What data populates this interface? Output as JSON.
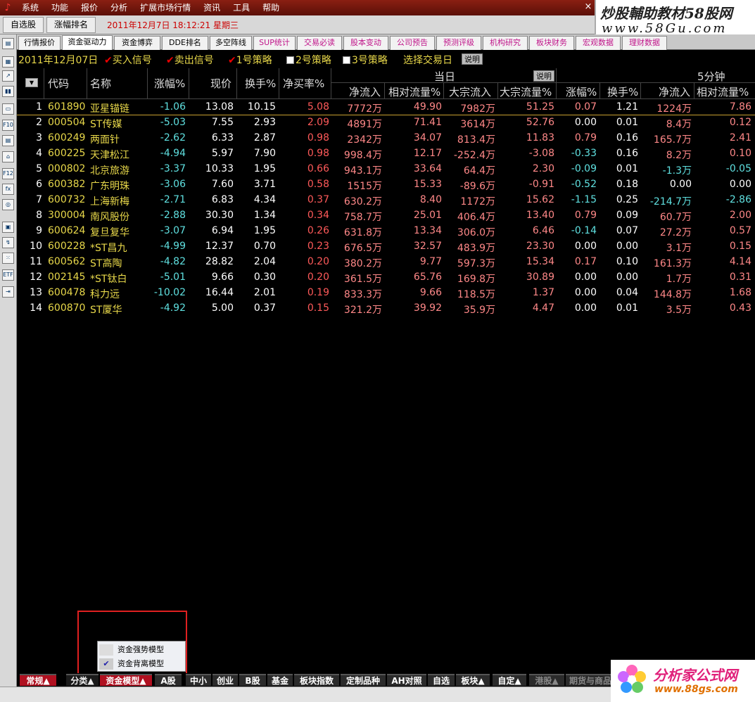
{
  "menu": {
    "items": [
      "系统",
      "功能",
      "报价",
      "分析",
      "扩展市场行情",
      "资讯",
      "工具",
      "帮助"
    ],
    "close": "×"
  },
  "watermark_top": {
    "line1": "炒股輔助教材58股网",
    "line2": "www.58Gu.com"
  },
  "toolbar": {
    "btn1": "自选股",
    "btn2": "涨幅排名",
    "datetime": "2011年12月7日  18:12:21 星期三"
  },
  "left_icons": [
    "▤",
    "▦",
    "↗",
    "▮▮",
    "▭",
    "F10",
    "▤",
    "⌂",
    "F12",
    "fx",
    "◎",
    "▣",
    "↯",
    "⁙",
    "ETF",
    "⇥"
  ],
  "tabs": [
    "行情报价",
    "资金驱动力",
    "资金博弈",
    "DDE排名",
    "多空阵线",
    "SUP统计",
    "交易必读",
    "股本变动",
    "公司预告",
    "预测评级",
    "机构研究",
    "板块财务",
    "宏观数据",
    "理财数据"
  ],
  "strategy": {
    "date": "2011年12月07日",
    "buy": "买入信号",
    "sell": "卖出信号",
    "s1": "1号策略",
    "s2": "2号策略",
    "s3": "3号策略",
    "select": "选择交易日",
    "explain": "说明"
  },
  "header": {
    "code": "代码",
    "name": "名称",
    "pct": "涨幅%",
    "price": "现价",
    "turnover": "换手%",
    "netbuy": "净买率%",
    "today": "当日",
    "explain": "说明",
    "five": "5分钟",
    "today_cols": [
      "净流入",
      "相对流量%",
      "大宗流入",
      "大宗流量%"
    ],
    "five_cols": [
      "涨幅%",
      "换手%",
      "净流入",
      "相对流量%"
    ]
  },
  "rows": [
    {
      "i": "1",
      "code": "601890",
      "name": "亚星锚链",
      "pct": "-1.06",
      "price": "13.08",
      "to": "10.15",
      "nb": "5.08",
      "ni": "7772万",
      "rf": "49.90",
      "bi": "7982万",
      "bf": "51.25",
      "p5": "0.07",
      "t5": "1.21",
      "n5": "1224万",
      "r5": "7.86"
    },
    {
      "i": "2",
      "code": "000504",
      "name": "ST传媒",
      "pct": "-5.03",
      "price": "7.55",
      "to": "2.93",
      "nb": "2.09",
      "ni": "4891万",
      "rf": "71.41",
      "bi": "3614万",
      "bf": "52.76",
      "p5": "0.00",
      "t5": "0.01",
      "n5": "8.4万",
      "r5": "0.12"
    },
    {
      "i": "3",
      "code": "600249",
      "name": "两面针",
      "pct": "-2.62",
      "price": "6.33",
      "to": "2.87",
      "nb": "0.98",
      "ni": "2342万",
      "rf": "34.07",
      "bi": "813.4万",
      "bf": "11.83",
      "p5": "0.79",
      "t5": "0.16",
      "n5": "165.7万",
      "r5": "2.41"
    },
    {
      "i": "4",
      "code": "600225",
      "name": "天津松江",
      "pct": "-4.94",
      "price": "5.97",
      "to": "7.90",
      "nb": "0.98",
      "ni": "998.4万",
      "rf": "12.17",
      "bi": "-252.4万",
      "bf": "-3.08",
      "p5": "-0.33",
      "t5": "0.16",
      "n5": "8.2万",
      "r5": "0.10"
    },
    {
      "i": "5",
      "code": "000802",
      "name": "北京旅游",
      "pct": "-3.37",
      "price": "10.33",
      "to": "1.95",
      "nb": "0.66",
      "ni": "943.1万",
      "rf": "33.64",
      "bi": "64.4万",
      "bf": "2.30",
      "p5": "-0.09",
      "t5": "0.01",
      "n5": "-1.3万",
      "r5": "-0.05"
    },
    {
      "i": "6",
      "code": "600382",
      "name": "广东明珠",
      "pct": "-3.06",
      "price": "7.60",
      "to": "3.71",
      "nb": "0.58",
      "ni": "1515万",
      "rf": "15.33",
      "bi": "-89.6万",
      "bf": "-0.91",
      "p5": "-0.52",
      "t5": "0.18",
      "n5": "0.00",
      "r5": "0.00"
    },
    {
      "i": "7",
      "code": "600732",
      "name": "上海新梅",
      "pct": "-2.71",
      "price": "6.83",
      "to": "4.34",
      "nb": "0.37",
      "ni": "630.2万",
      "rf": "8.40",
      "bi": "1172万",
      "bf": "15.62",
      "p5": "-1.15",
      "t5": "0.25",
      "n5": "-214.7万",
      "r5": "-2.86"
    },
    {
      "i": "8",
      "code": "300004",
      "name": "南风股份",
      "pct": "-2.88",
      "price": "30.30",
      "to": "1.34",
      "nb": "0.34",
      "ni": "758.7万",
      "rf": "25.01",
      "bi": "406.4万",
      "bf": "13.40",
      "p5": "0.79",
      "t5": "0.09",
      "n5": "60.7万",
      "r5": "2.00"
    },
    {
      "i": "9",
      "code": "600624",
      "name": "复旦复华",
      "pct": "-3.07",
      "price": "6.94",
      "to": "1.95",
      "nb": "0.26",
      "ni": "631.8万",
      "rf": "13.34",
      "bi": "306.0万",
      "bf": "6.46",
      "p5": "-0.14",
      "t5": "0.07",
      "n5": "27.2万",
      "r5": "0.57"
    },
    {
      "i": "10",
      "code": "600228",
      "name": "*ST昌九",
      "pct": "-4.99",
      "price": "12.37",
      "to": "0.70",
      "nb": "0.23",
      "ni": "676.5万",
      "rf": "32.57",
      "bi": "483.9万",
      "bf": "23.30",
      "p5": "0.00",
      "t5": "0.00",
      "n5": "3.1万",
      "r5": "0.15"
    },
    {
      "i": "11",
      "code": "600562",
      "name": "ST高陶",
      "pct": "-4.82",
      "price": "28.82",
      "to": "2.04",
      "nb": "0.20",
      "ni": "380.2万",
      "rf": "9.77",
      "bi": "597.3万",
      "bf": "15.34",
      "p5": "0.17",
      "t5": "0.10",
      "n5": "161.3万",
      "r5": "4.14"
    },
    {
      "i": "12",
      "code": "002145",
      "name": "*ST钛白",
      "pct": "-5.01",
      "price": "9.66",
      "to": "0.30",
      "nb": "0.20",
      "ni": "361.5万",
      "rf": "65.76",
      "bi": "169.8万",
      "bf": "30.89",
      "p5": "0.00",
      "t5": "0.00",
      "n5": "1.7万",
      "r5": "0.31"
    },
    {
      "i": "13",
      "code": "600478",
      "name": "科力远",
      "pct": "-10.02",
      "price": "16.44",
      "to": "2.01",
      "nb": "0.19",
      "ni": "833.3万",
      "rf": "9.66",
      "bi": "118.5万",
      "bf": "1.37",
      "p5": "0.00",
      "t5": "0.04",
      "n5": "144.8万",
      "r5": "1.68"
    },
    {
      "i": "14",
      "code": "600870",
      "name": "ST厦华",
      "pct": "-4.92",
      "price": "5.00",
      "to": "0.37",
      "nb": "0.15",
      "ni": "321.2万",
      "rf": "39.92",
      "bi": "35.9万",
      "bf": "4.47",
      "p5": "0.00",
      "t5": "0.01",
      "n5": "3.5万",
      "r5": "0.43"
    }
  ],
  "popup": {
    "item1": "资金强势模型",
    "item2": "资金背离模型",
    "check": "✔"
  },
  "bottom_tabs": [
    "常规▲",
    "分类▲",
    "资金模型▲",
    "A股",
    "中小",
    "创业",
    "B股",
    "基金",
    "板块指数",
    "定制品种",
    "AH对照",
    "自选",
    "板块▲",
    "自定▲",
    "港股▲",
    "期货与商品"
  ],
  "logo88": {
    "t1": "分析家公式网",
    "t2": "www.88gs.com"
  },
  "colors": {
    "menu_bg": "#8a1f12",
    "header_text": "#dddddd",
    "code_yellow": "#e8d84a",
    "neg_cyan": "#5fe0e0",
    "pos_red": "#ff5a5a",
    "highlight_frame": "#e02020"
  }
}
